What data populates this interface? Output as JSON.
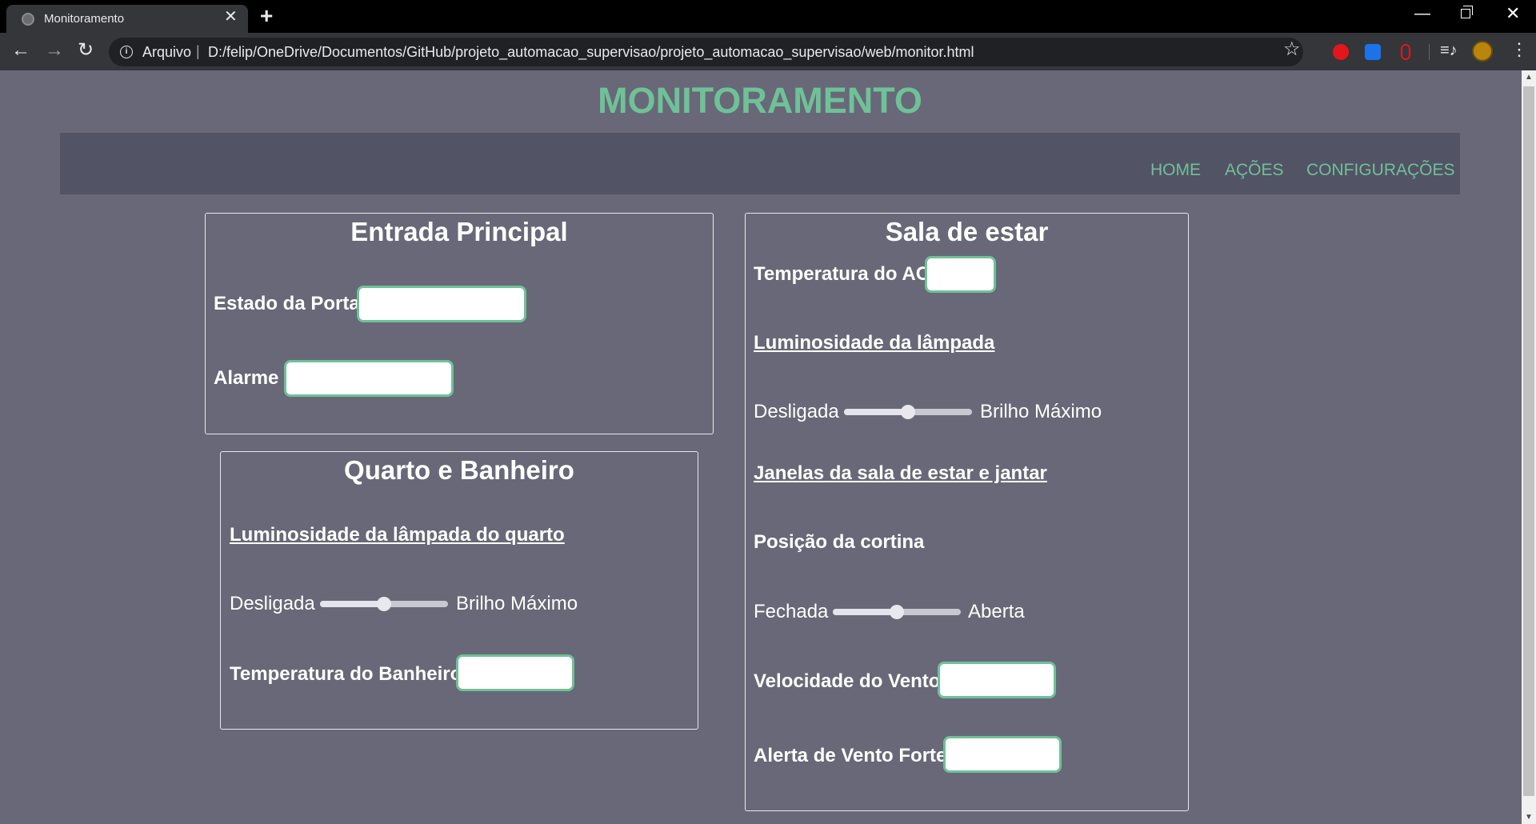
{
  "browser": {
    "tab_title": "Monitoramento",
    "tab_close": "✕",
    "new_tab": "+",
    "url_scheme": "Arquivo",
    "url_separator": "|",
    "url": "D:/felip/OneDrive/Documentos/GitHub/projeto_automacao_supervisao/projeto_automacao_supervisao/web/monitor.html",
    "back": "←",
    "forward": "→",
    "reload": "↻",
    "star": "☆",
    "menu": "⋮",
    "media": "≡♪",
    "minimize": "—",
    "close": "✕"
  },
  "page": {
    "title": "MONITORAMENTO",
    "accent_color": "#6fc197",
    "background_color": "#686878"
  },
  "nav": {
    "home": "HOME",
    "acoes": "AÇÕES",
    "config": "CONFIGURAÇÕES"
  },
  "entrada": {
    "title": "Entrada Principal",
    "estado_porta": "Estado da Porta",
    "alarme": "Alarme"
  },
  "quarto": {
    "title": "Quarto e Banheiro",
    "luminosidade": "Luminosidade da lâmpada do quarto",
    "slider_min": "Desligada",
    "slider_max": "Brilho Máximo",
    "slider_value": 0.5,
    "temp_banheiro": "Temperatura do Banheiro"
  },
  "sala": {
    "title": "Sala de estar",
    "temp_ac": "Temperatura do AC",
    "luminosidade": "Luminosidade da lâmpada",
    "lamp_min": "Desligada",
    "lamp_max": "Brilho Máximo",
    "lamp_value": 0.5,
    "janelas": "Janelas da sala de estar e jantar",
    "cortina": "Posição da cortina",
    "cortina_min": "Fechada",
    "cortina_max": "Aberta",
    "cortina_value": 0.5,
    "vento": "Velocidade do Vento",
    "alerta_vento": "Alerta de Vento Forte"
  }
}
